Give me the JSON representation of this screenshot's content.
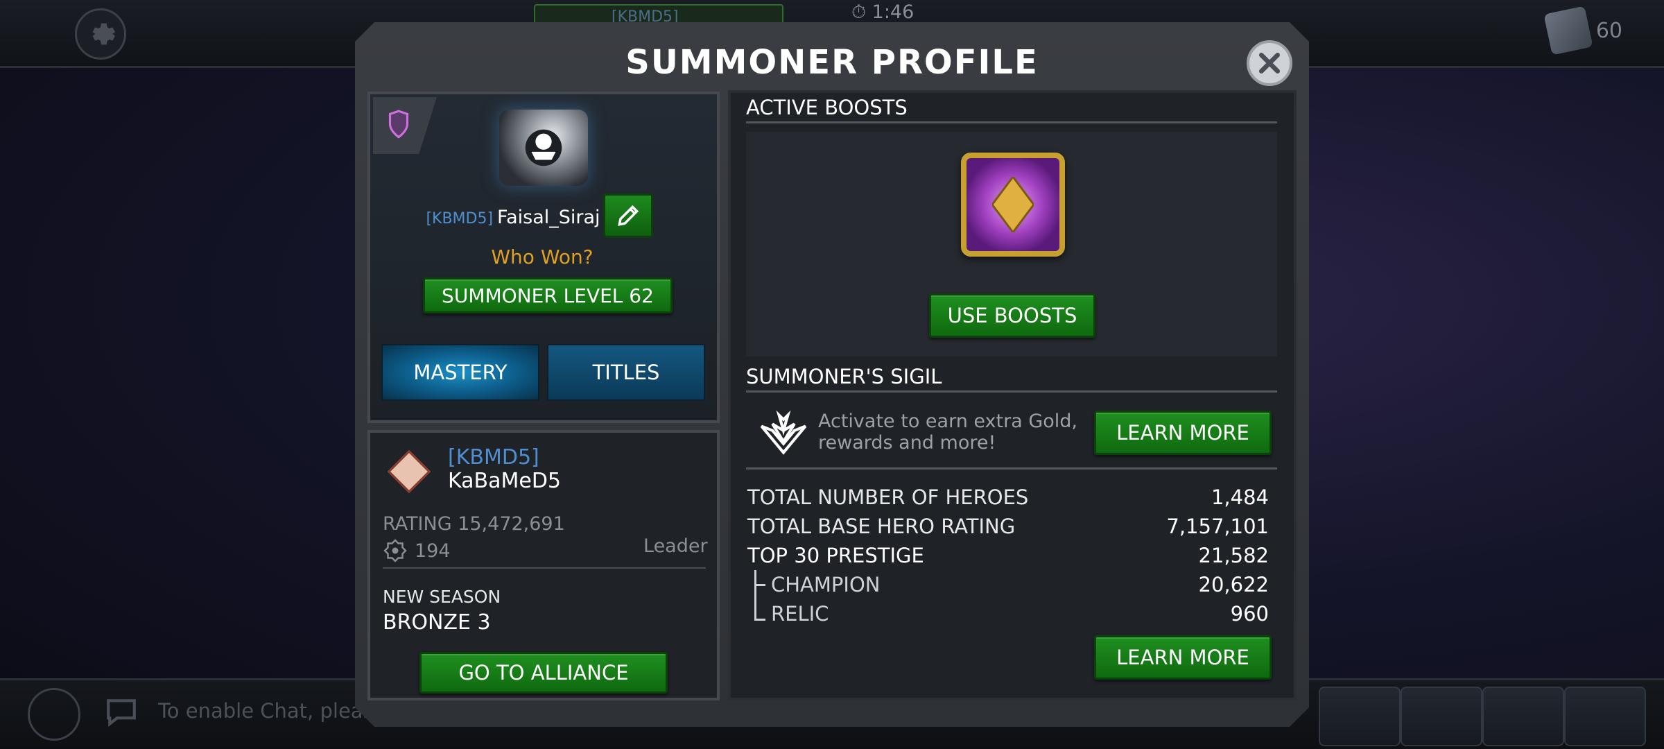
{
  "background": {
    "timer": "1:46",
    "alliance_tag_text": "[KBMD5] Faisal_Siraj",
    "units_count": "60",
    "chat_placeholder": "To enable Chat, please"
  },
  "dialog": {
    "title": "SUMMONER PROFILE"
  },
  "profile": {
    "tag": "[KBMD5]",
    "name": "Faisal_Siraj",
    "title": "Who Won?",
    "level_label": "SUMMONER LEVEL 62",
    "tabs": [
      {
        "label": "MASTERY",
        "active": true
      },
      {
        "label": "TITLES",
        "active": false
      }
    ]
  },
  "alliance": {
    "tag": "[KBMD5]",
    "name": "KaBaMeD5",
    "rating": "RATING 15,472,691",
    "members": "194",
    "role": "Leader",
    "season_label": "NEW SEASON",
    "season_value": "BRONZE 3",
    "go_button": "GO TO ALLIANCE"
  },
  "boosts": {
    "section_title": "ACTIVE BOOSTS",
    "use_button": "USE BOOSTS"
  },
  "sigil": {
    "section_title": "SUMMONER'S SIGIL",
    "description": "Activate to earn extra Gold, rewards and more!",
    "learn_more": "LEARN MORE"
  },
  "stats": {
    "rows": [
      {
        "label": "TOTAL NUMBER OF HEROES",
        "value": "1,484"
      },
      {
        "label": "TOTAL BASE HERO RATING",
        "value": "7,157,101"
      },
      {
        "label": "TOP 30 PRESTIGE",
        "value": "21,582"
      },
      {
        "label": "CHAMPION",
        "value": "20,622"
      },
      {
        "label": "RELIC",
        "value": "960"
      }
    ],
    "learn_more": "LEARN MORE"
  },
  "colors": {
    "accent_green": "#1f8f1f",
    "tag_blue": "#4f8fd0",
    "title_gold": "#e0a020",
    "tab_blue": "#1b8fc7"
  }
}
